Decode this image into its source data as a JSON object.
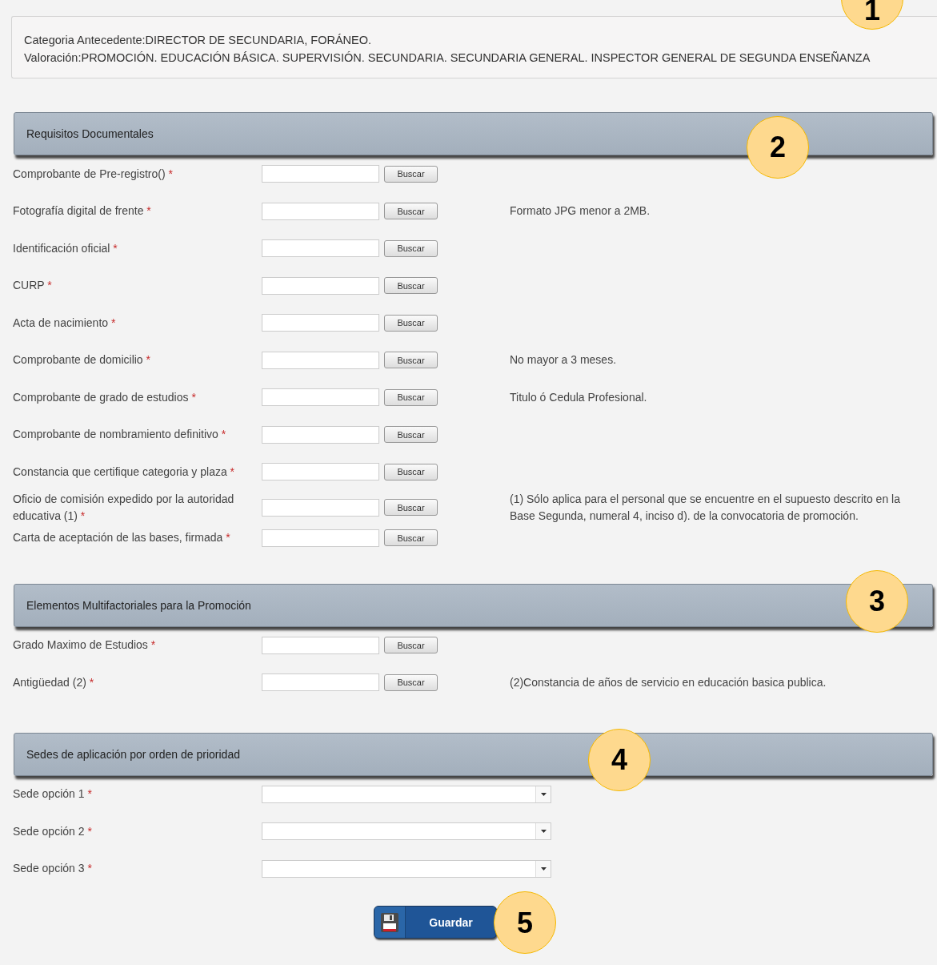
{
  "info": {
    "lines": [
      "Categoria Antecedente:DIRECTOR DE SECUNDARIA, FORÁNEO.",
      "Valoración:PROMOCIÓN. EDUCACIÓN BÁSICA. SUPERVISIÓN. SECUNDARIA. SECUNDARIA GENERAL. INSPECTOR GENERAL DE SEGUNDA ENSEÑANZA"
    ],
    "callout": "1"
  },
  "sections": [
    {
      "title": "Requisitos Documentales",
      "callout": "2",
      "kind": "files",
      "rows": [
        {
          "label": "Comprobante de Pre-registro()",
          "mark": "*",
          "button": "Buscar"
        },
        {
          "label": "Fotografía digital de frente",
          "mark": "*",
          "button": "Buscar",
          "note": "Formato JPG menor a 2MB."
        },
        {
          "label": "Identificación oficial",
          "mark": "*",
          "button": "Buscar"
        },
        {
          "label": "CURP",
          "mark": "*",
          "button": "Buscar"
        },
        {
          "label": "Acta de nacimiento",
          "mark": "*",
          "button": "Buscar"
        },
        {
          "label": "Comprobante de domicilio",
          "mark": "*",
          "button": "Buscar",
          "note": "No mayor a 3 meses."
        },
        {
          "label": "Comprobante de grado de estudios",
          "mark": "*",
          "button": "Buscar",
          "note": "Titulo ó Cedula Profesional."
        },
        {
          "label": "Comprobante de nombramiento definitivo",
          "mark": "*",
          "button": "Buscar"
        },
        {
          "label": "Constancia que certifique categoria y plaza",
          "mark": "*",
          "button": "Buscar"
        },
        {
          "label": "Oficio de comisión expedido por la autoridad educativa (1)",
          "mark": "*",
          "button": "Buscar",
          "note": "(1) Sólo aplica para el personal que se encuentre en el supuesto descrito en la Base Segunda, numeral 4, inciso d). de la convocatoria de promoción."
        },
        {
          "label": "Carta de aceptación de las bases, firmada",
          "mark": "*",
          "button": "Buscar"
        }
      ]
    },
    {
      "title": "Elementos Multifactoriales para la Promoción",
      "callout": "3",
      "kind": "files",
      "rows": [
        {
          "label": "Grado Maximo de Estudios",
          "mark": "*",
          "button": "Buscar"
        },
        {
          "label": "Antigüedad (2)",
          "mark": "*",
          "button": "Buscar",
          "note": "(2)Constancia de años de servicio en educación basica publica."
        }
      ]
    },
    {
      "title": "Sedes de aplicación por orden de prioridad",
      "callout": "4",
      "kind": "selects",
      "rows": [
        {
          "label": "Sede opción 1",
          "mark": "*"
        },
        {
          "label": "Sede opción 2",
          "mark": "*"
        },
        {
          "label": "Sede opción 3",
          "mark": "*"
        }
      ]
    }
  ],
  "save": {
    "label": "Guardar",
    "callout": "5"
  }
}
